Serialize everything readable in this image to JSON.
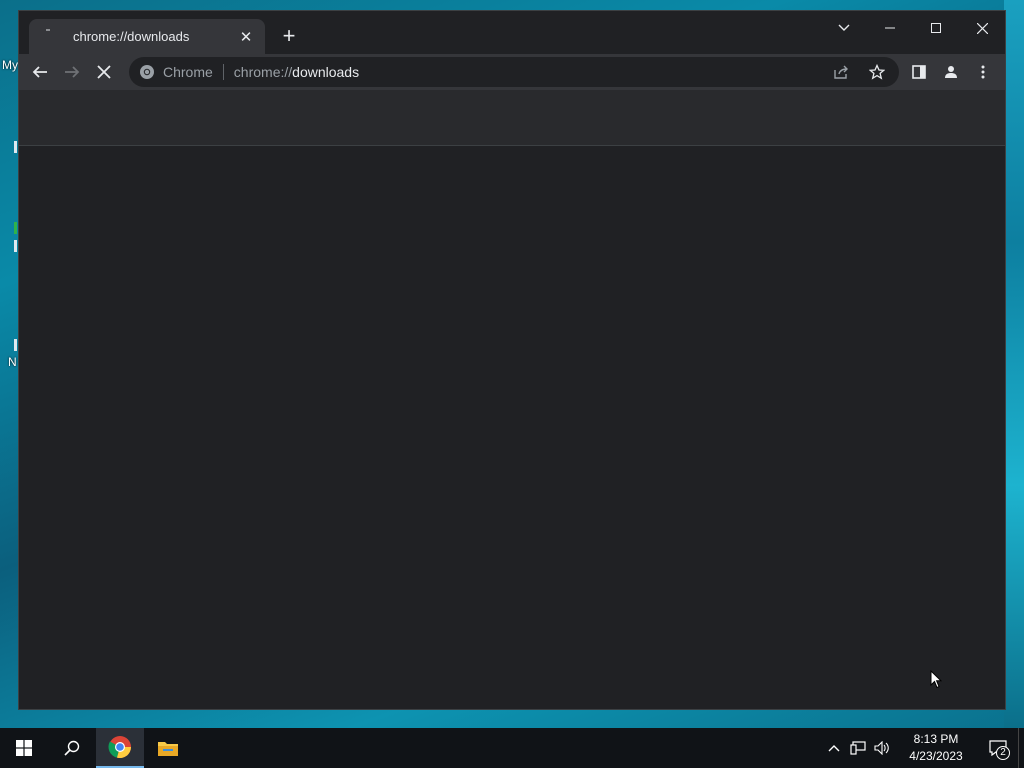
{
  "desktop": {
    "icon_labels": [
      "My",
      "N"
    ]
  },
  "browser": {
    "tab": {
      "title": "chrome://downloads",
      "close_glyph": "✕"
    },
    "new_tab_glyph": "+",
    "omnibox": {
      "chip": "Chrome",
      "url_scheme": "chrome://",
      "url_host": "downloads"
    },
    "icons": {
      "back": "arrow-left-icon",
      "forward": "arrow-right-icon",
      "stop": "close-icon",
      "share": "share-icon",
      "bookmark": "star-icon",
      "side_panel": "side-panel-icon",
      "profile": "person-icon",
      "menu": "kebab-menu-icon"
    },
    "window_controls": [
      "tab-search-icon",
      "minimize-icon",
      "maximize-icon",
      "close-icon"
    ]
  },
  "taskbar": {
    "clock_time": "8:13 PM",
    "clock_date": "4/23/2023",
    "notification_count": "2",
    "apps": [
      "start",
      "search",
      "chrome",
      "file-explorer"
    ]
  },
  "colors": {
    "window_bg": "#202124",
    "toolbar_bg": "#35363a",
    "header_bg": "#292a2d",
    "taskbar_bg": "#101317",
    "accent": "#76b9ed"
  }
}
